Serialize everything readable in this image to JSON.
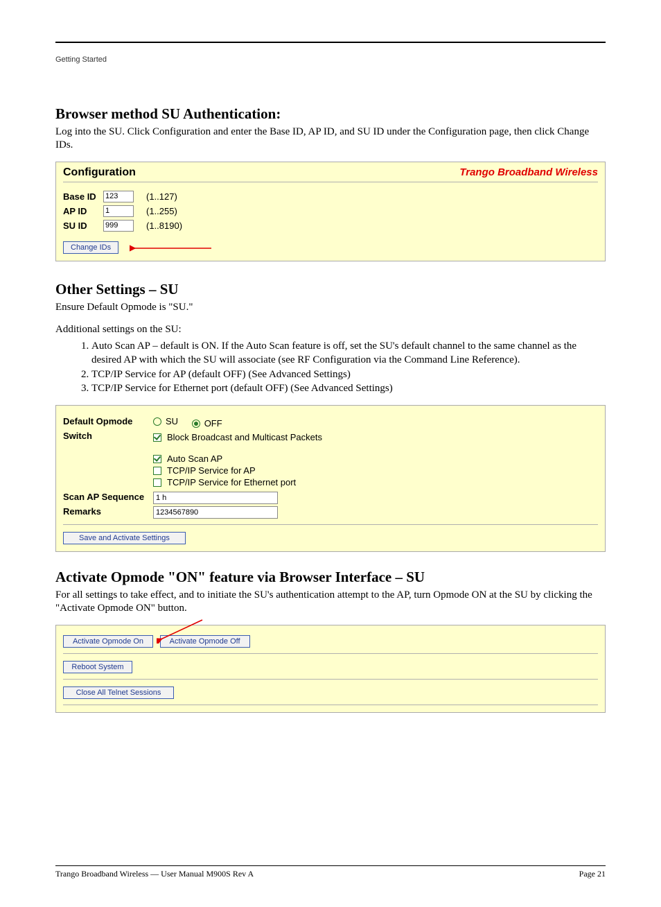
{
  "doc": {
    "running_header": "Getting Started",
    "title1": "Browser method SU Authentication:",
    "desc1": "Log into the SU.  Click Configuration and enter the Base ID, AP ID, and SU ID under the Configuration page, then click Change IDs.",
    "footer_left": "Trango Broadband Wireless — User Manual M900S Rev A",
    "footer_right": "Page 21"
  },
  "panel1": {
    "title": "Configuration",
    "brand": "Trango Broadband Wireless",
    "rows": [
      {
        "label": "Base ID",
        "value": "123",
        "range": "(1..127)"
      },
      {
        "label": "AP ID",
        "value": "1",
        "range": "(1..255)"
      },
      {
        "label": "SU ID",
        "value": "999",
        "range": "(1..8190)"
      }
    ],
    "button": "Change IDs"
  },
  "section2": {
    "heading": "Other Settings – SU",
    "intro": "Ensure Default Opmode is \"SU.\"",
    "list_intro": "Additional settings on the SU:",
    "items": [
      "Auto Scan AP – default is ON.  If the Auto Scan feature is off, set the SU's default channel to the same channel as the desired AP with which the SU will associate (see RF Configuration via the Command Line Reference).",
      "TCP/IP Service for AP (default OFF)  (See Advanced Settings)",
      "TCP/IP Service for Ethernet port (default OFF)  (See Advanced Settings)"
    ]
  },
  "panel2": {
    "row1_label": "Default Opmode",
    "radio_su": "SU",
    "radio_off": "OFF",
    "row2_label": "Switch",
    "cb_block": "Block Broadcast and Multicast Packets",
    "cb_autoscan": "Auto Scan AP",
    "cb_tcpip_ap": "TCP/IP Service for AP",
    "cb_tcpip_eth": "TCP/IP Service for Ethernet port",
    "scan_label": "Scan AP Sequence",
    "scan_value": "1 h",
    "remarks_label": "Remarks",
    "remarks_value": "1234567890",
    "save_btn": "Save and Activate Settings"
  },
  "section3": {
    "heading": "Activate Opmode \"ON\" feature via Browser Interface – SU",
    "body": "For all settings to take effect, and to initiate the SU's authentication attempt to the AP, turn Opmode ON at the SU by clicking the \"Activate Opmode ON\" button."
  },
  "panel3": {
    "btn_on": "Activate Opmode On",
    "btn_off": "Activate Opmode Off",
    "btn_reboot": "Reboot System",
    "btn_close": "Close All Telnet Sessions"
  }
}
